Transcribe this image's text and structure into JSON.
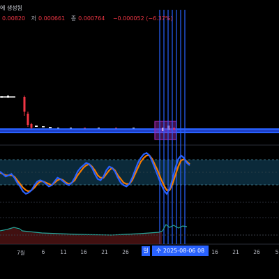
{
  "header": {
    "title": "에 생성됨",
    "ohlc": [
      {
        "label": "",
        "value": "0.00820"
      },
      {
        "label": "저",
        "value": "0.000661"
      },
      {
        "label": "종",
        "value": "0.000764"
      },
      {
        "label": "",
        "value": "−0.000052 (−6.37%)"
      }
    ]
  },
  "x_axis": {
    "labels": [
      "7월",
      "6",
      "11",
      "16",
      "21",
      "26",
      "16",
      "21",
      "26",
      "5"
    ],
    "crosshair_day": "일",
    "crosshair_date": "수 2025-08-06",
    "crosshair_time": "08"
  },
  "colors": {
    "background": "#000000",
    "up": "#ffffff",
    "down": "#f23645",
    "highlight_band": "#2962ff",
    "crosshair_lines": "#2962ff",
    "rsi_line_1": "#2962ff",
    "rsi_line_2": "#f57c00",
    "rsi_band": "#0b2a3a",
    "selection_box": "#9c27b0",
    "oscillator_line": "#26a69a",
    "oscillator_fill": "#6d1b1b"
  },
  "chart_data": {
    "type": "line",
    "series": [
      {
        "values": [
          52,
          50,
          48,
          49,
          50,
          47,
          43,
          40,
          36,
          34,
          35,
          37,
          41,
          44,
          45,
          44,
          42,
          40,
          41,
          44,
          47,
          46,
          44,
          42,
          41,
          43,
          47,
          52,
          55,
          57,
          59,
          58,
          55,
          50,
          46,
          45,
          48,
          53,
          56,
          55,
          52,
          47,
          43,
          41,
          40,
          42,
          47,
          53,
          59,
          63,
          66,
          67,
          65,
          60,
          54,
          48,
          42,
          37,
          34,
          38,
          46,
          55,
          62,
          65,
          63,
          59,
          57
        ]
      },
      {
        "values": [
          51,
          50,
          49,
          49,
          49,
          48,
          45,
          42,
          39,
          37,
          36,
          37,
          39,
          42,
          44,
          44,
          43,
          42,
          41,
          43,
          45,
          46,
          45,
          43,
          42,
          43,
          45,
          49,
          52,
          55,
          57,
          58,
          56,
          53,
          49,
          47,
          47,
          50,
          53,
          55,
          53,
          49,
          46,
          43,
          42,
          42,
          45,
          50,
          55,
          60,
          63,
          65,
          65,
          62,
          57,
          52,
          46,
          41,
          37,
          37,
          42,
          49,
          56,
          61,
          62,
          60,
          58
        ]
      }
    ]
  }
}
